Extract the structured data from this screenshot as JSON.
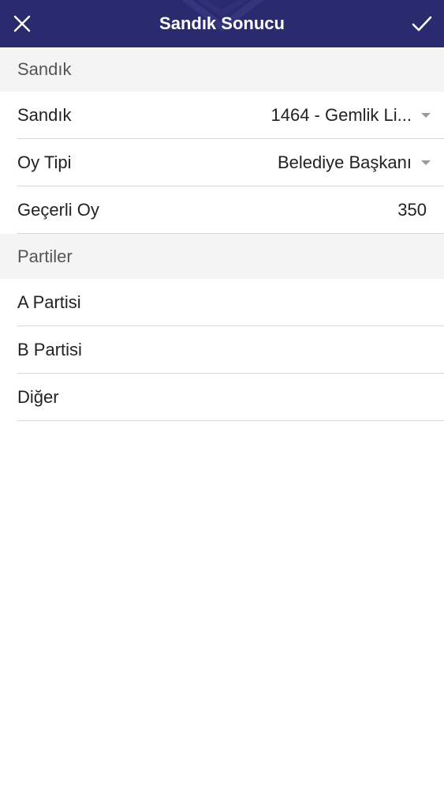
{
  "header": {
    "title": "Sandık Sonucu",
    "close_icon": "close-icon",
    "confirm_icon": "check-icon",
    "background_color": "#2a2b6e"
  },
  "section_sandik": {
    "title": "Sandık",
    "rows": [
      {
        "label": "Sandık",
        "value": "1464 - Gemlik Li..."
      },
      {
        "label": "Oy Tipi",
        "value": "Belediye Başkanı"
      },
      {
        "label": "Geçerli Oy",
        "value": "350"
      }
    ]
  },
  "section_partiler": {
    "title": "Partiler",
    "rows": [
      {
        "label": "A Partisi",
        "value": ""
      },
      {
        "label": "B Partisi",
        "value": ""
      },
      {
        "label": "Diğer",
        "value": ""
      }
    ]
  }
}
